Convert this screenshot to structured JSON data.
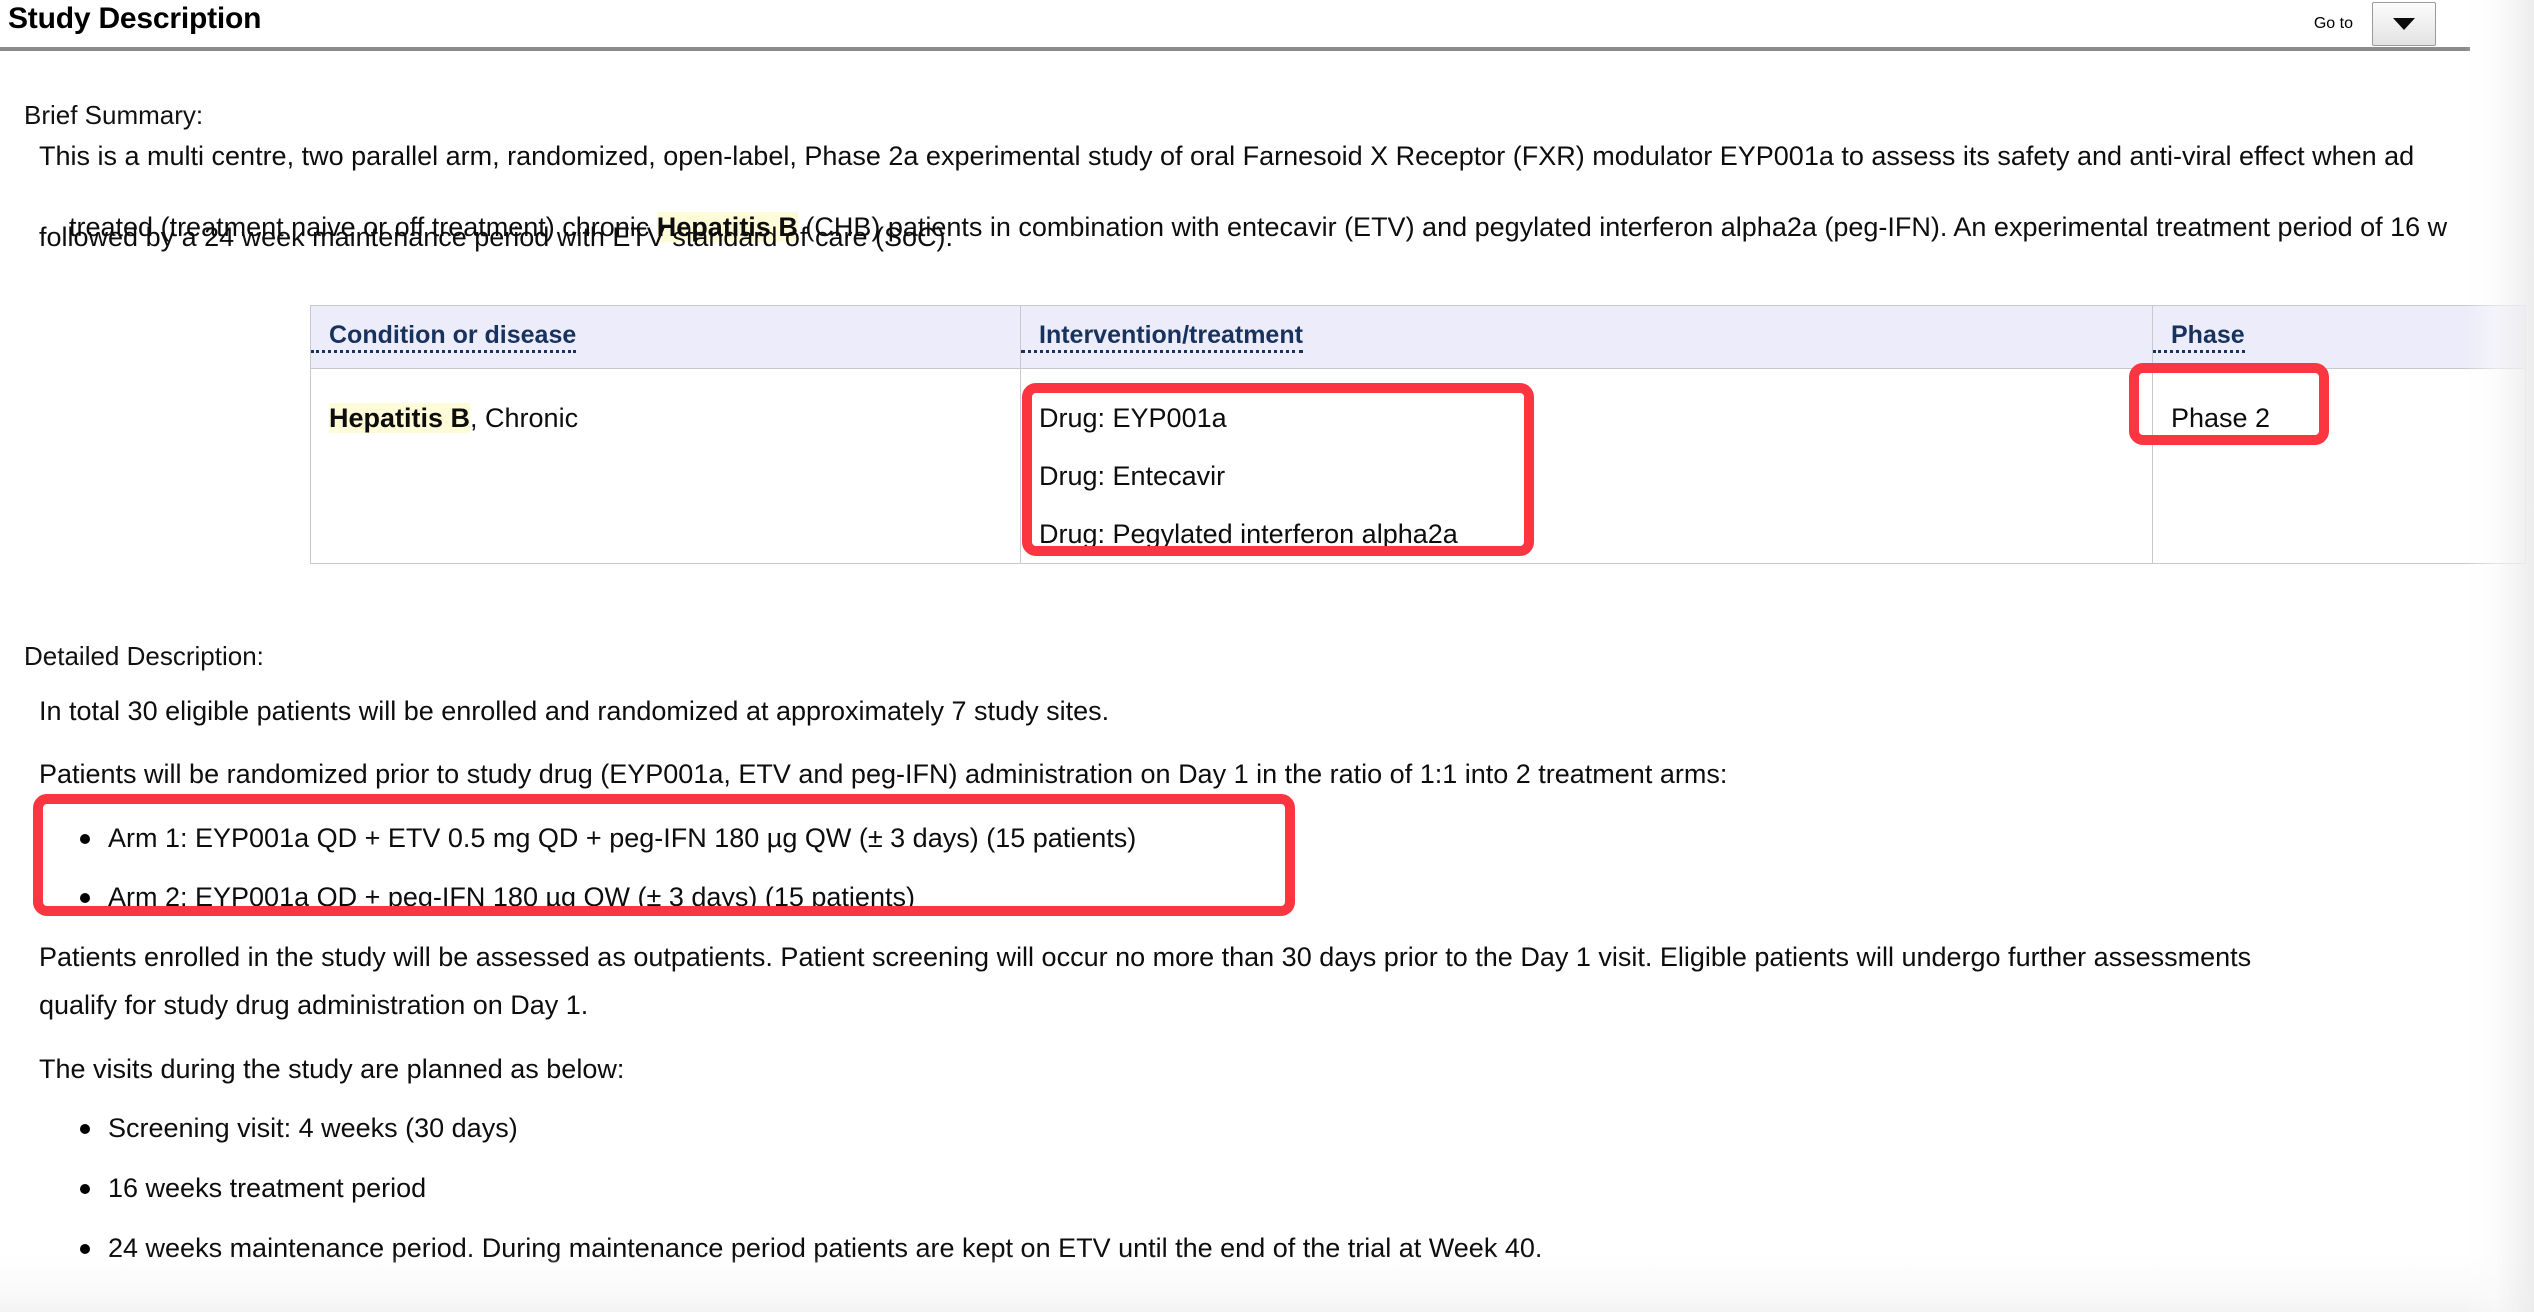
{
  "header": {
    "title": "Study Description",
    "goto_label": "Go to",
    "goto_caret_icon": "chevron-down-icon"
  },
  "brief_summary": {
    "label": "Brief Summary:",
    "lines": [
      {
        "pre": "This is a multi centre, two parallel arm, randomized, open-label, Phase 2a experimental study of oral Farnesoid X Receptor (FXR) modulator EYP001a to assess its safety and anti-viral effect when ad"
      },
      {
        "pre": "treated (treatment naive or off treatment) chronic ",
        "highlight": "Hepatitis B",
        "post": " (CHB) patients in combination with entecavir (ETV) and pegylated interferon alpha2a (peg-IFN). An experimental treatment period of 16 w"
      },
      {
        "pre": "followed by a 24 week maintenance period with ETV standard of care (SoC)."
      }
    ]
  },
  "conditions_table": {
    "headers": [
      "Condition or disease",
      "Intervention/treatment",
      "Phase"
    ],
    "row": {
      "condition_highlight": "Hepatitis B",
      "condition_rest": ", Chronic",
      "interventions": [
        "Drug: EYP001a",
        "Drug: Entecavir",
        "Drug: Pegylated interferon alpha2a"
      ],
      "phase": "Phase 2"
    }
  },
  "detailed_description": {
    "label": "Detailed Description:",
    "para_enrolled": "In total 30 eligible patients will be enrolled and randomized at approximately 7 study sites.",
    "para_randomized": "Patients will be randomized prior to study drug (EYP001a, ETV and peg-IFN) administration on Day 1 in the ratio of 1:1 into 2 treatment arms:",
    "arms": [
      "Arm 1: EYP001a QD + ETV 0.5 mg QD + peg-IFN 180 µg QW (± 3 days) (15 patients)",
      "Arm 2: EYP001a QD + peg-IFN 180 µg QW (± 3 days) (15 patients)"
    ],
    "para_outpatients_line1": "Patients enrolled in the study will be assessed as outpatients. Patient screening will occur no more than 30 days prior to the Day 1 visit. Eligible patients will undergo further assessments",
    "para_outpatients_line2": "qualify for study drug administration on Day 1.",
    "visits_label": "The visits during the study are planned as below:",
    "visits": [
      "Screening visit: 4 weeks (30 days)",
      "16 weeks treatment period",
      "24 weeks maintenance period. During maintenance period patients are kept on ETV until the end of the trial at Week 40."
    ]
  },
  "annotations": {
    "accent_color": "#fb3640",
    "highlight_color": "#fdfbd8",
    "table_header_bg": "#ececfa",
    "table_header_text": "#17325c"
  }
}
